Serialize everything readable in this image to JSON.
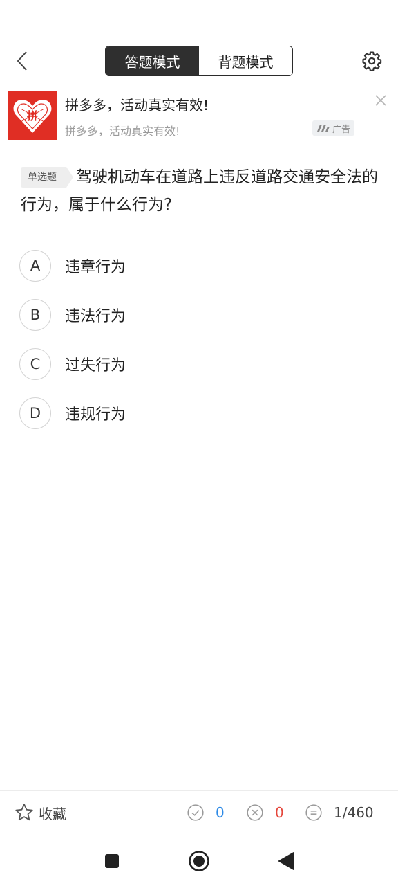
{
  "header": {
    "modes": [
      {
        "label": "答题模式",
        "active": true
      },
      {
        "label": "背题模式",
        "active": false
      }
    ]
  },
  "ad": {
    "logo_text": "拼",
    "title": "拼多多，活动真实有效!",
    "subtitle": "拼多多，活动真实有效!",
    "tag": "广告"
  },
  "question": {
    "type": "单选题",
    "text": "驾驶机动车在道路上违反道路交通安全法的行为，属于什么行为?",
    "options": [
      {
        "letter": "A",
        "text": "违章行为"
      },
      {
        "letter": "B",
        "text": "违法行为"
      },
      {
        "letter": "C",
        "text": "过失行为"
      },
      {
        "letter": "D",
        "text": "违规行为"
      }
    ]
  },
  "bottom": {
    "favorite_label": "收藏",
    "correct_count": "0",
    "wrong_count": "0",
    "progress": "1/460"
  },
  "colors": {
    "correct": "#2e8ae6",
    "wrong": "#e5473c",
    "brand_red": "#e02e24",
    "active_tab": "#2f2f2f"
  }
}
